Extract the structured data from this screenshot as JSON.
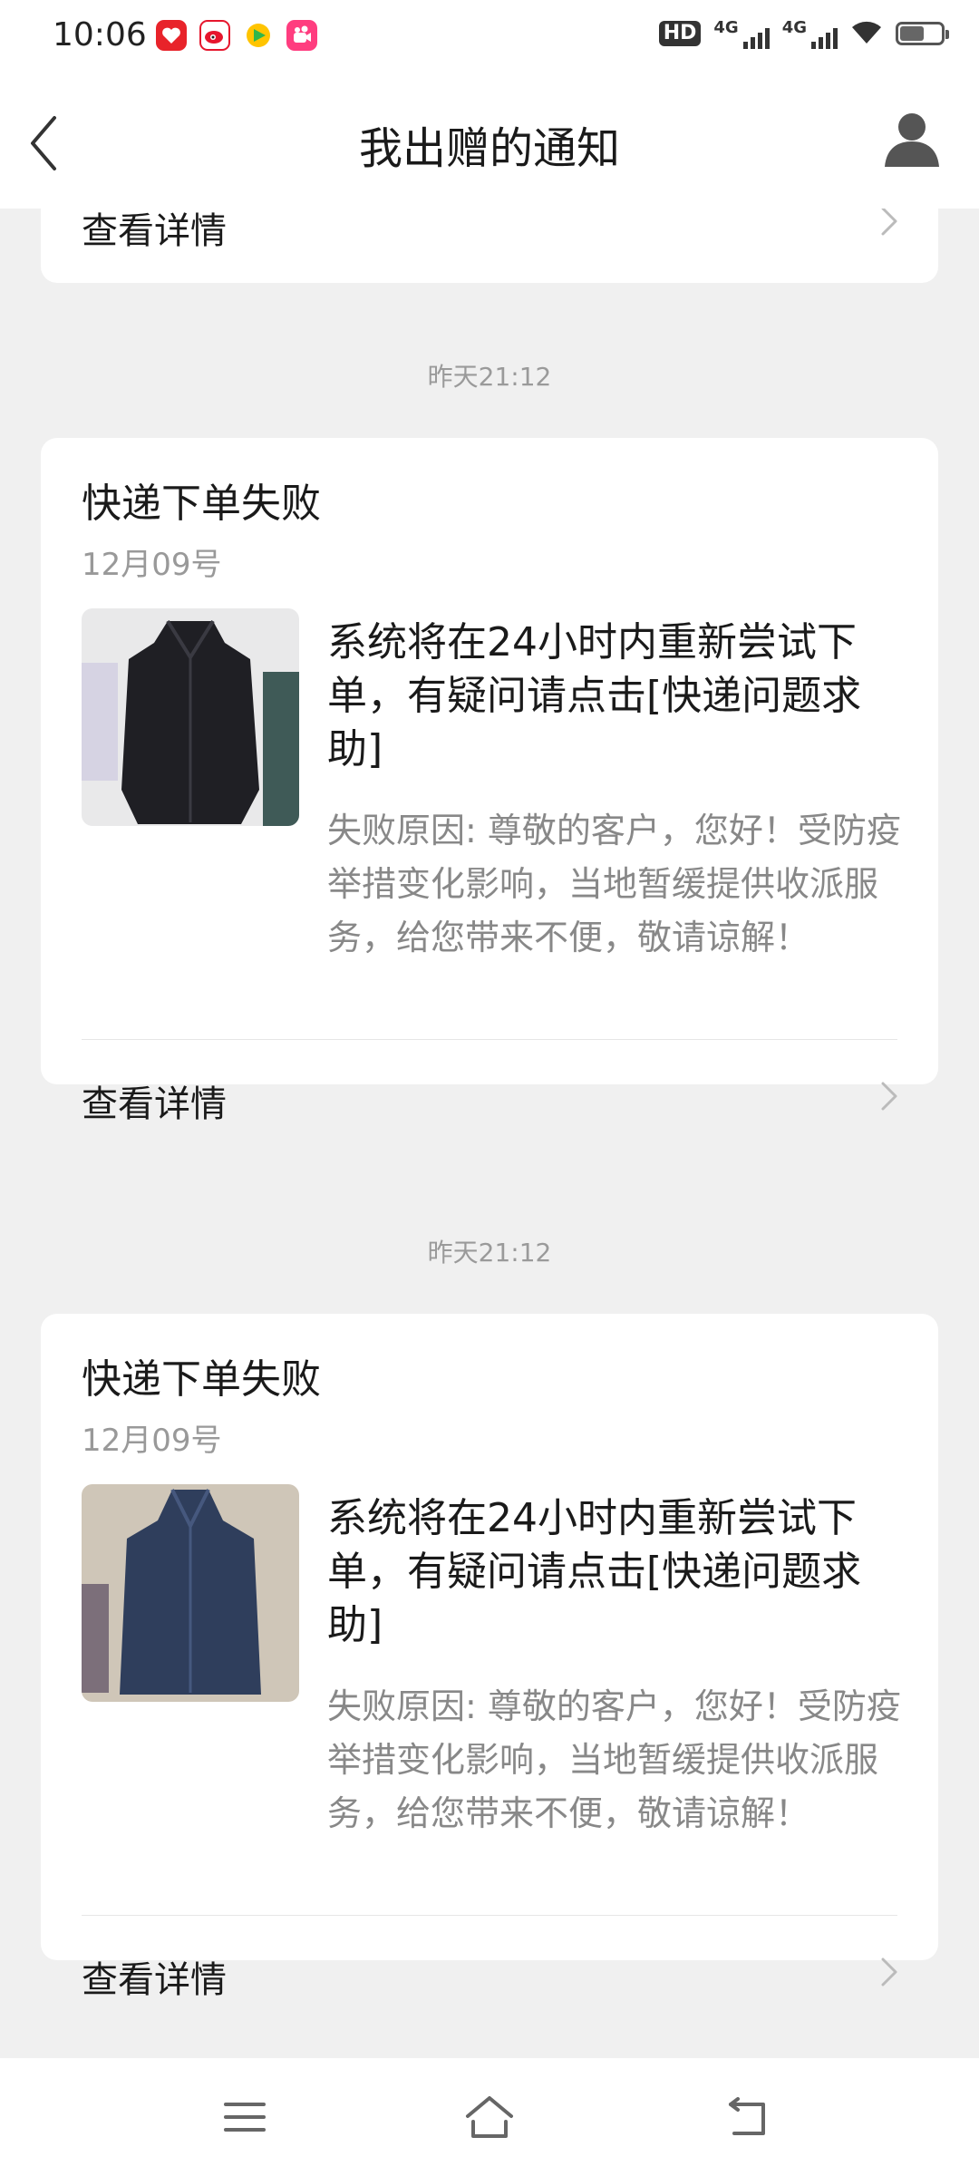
{
  "status_bar": {
    "time": "10:06",
    "hd_label": "HD",
    "network_1": "4G",
    "network_2": "4G"
  },
  "header": {
    "title": "我出赠的通知",
    "back_icon": "chevron-left-icon",
    "profile_icon": "user-avatar-icon"
  },
  "notifications": [
    {
      "detail_label": "查看详情"
    },
    {
      "time": "昨天21:12",
      "title": "快递下单失败",
      "date": "12月09号",
      "message": "系统将在24小时内重新尝试下单，有疑问请点击[快递问题求助]",
      "reason": "失败原因: 尊敬的客户，您好！受防疫举措变化影响，当地暂缓提供收派服务，给您带来不便，敬请谅解！",
      "detail_label": "查看详情",
      "thumb_color": "#1f1f24"
    },
    {
      "time": "昨天21:12",
      "title": "快递下单失败",
      "date": "12月09号",
      "message": "系统将在24小时内重新尝试下单，有疑问请点击[快递问题求助]",
      "reason": "失败原因: 尊敬的客户，您好！受防疫举措变化影响，当地暂缓提供收派服务，给您带来不便，敬请谅解！",
      "detail_label": "查看详情",
      "thumb_color": "#2f3e5c"
    }
  ],
  "nav_bar": {
    "menu_icon": "menu-icon",
    "home_icon": "home-icon",
    "back_icon": "back-icon"
  }
}
